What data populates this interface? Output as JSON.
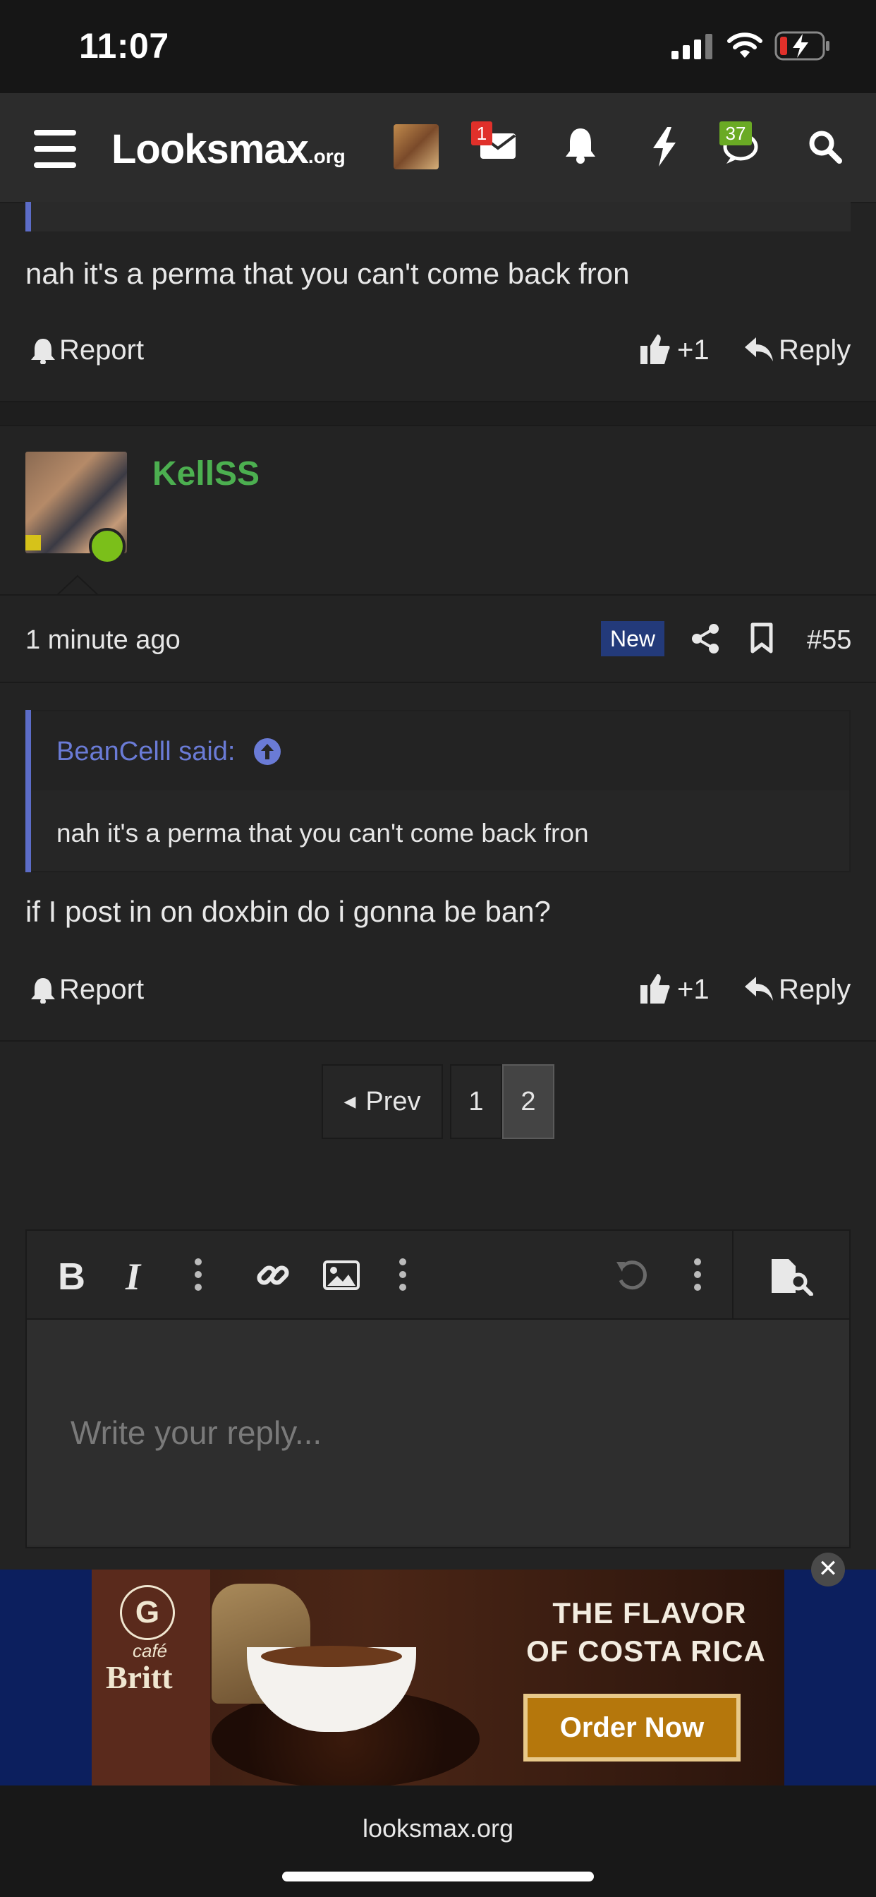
{
  "status_bar": {
    "time": "11:07"
  },
  "nav": {
    "logo_main": "Looksmax",
    "logo_tld": ".org",
    "inbox_count": "1",
    "alerts_count": "37"
  },
  "prev_post": {
    "body": "nah it's a perma that you can't come back fron",
    "report_label": "Report",
    "like_count": "+1",
    "reply_label": "Reply"
  },
  "post": {
    "username": "KellSS",
    "time": "1 minute ago",
    "new_badge": "New",
    "post_number": "#55",
    "quote": {
      "author": "BeanCelll said:",
      "text": "nah it's a perma that you can't come back fron"
    },
    "body": "if I post in on doxbin do i gonna be ban?",
    "report_label": "Report",
    "like_count": "+1",
    "reply_label": "Reply"
  },
  "pagination": {
    "prev_label": "Prev",
    "pages": [
      "1",
      "2"
    ],
    "current_page": "2"
  },
  "editor": {
    "placeholder": "Write your reply..."
  },
  "ad": {
    "brand_top": "café",
    "brand": "Britt",
    "headline_1": "THE FLAVOR",
    "headline_2": "OF COSTA RICA",
    "cta": "Order Now"
  },
  "browser": {
    "url": "looksmax.org"
  },
  "colors": {
    "username_green": "#4caf50",
    "link_blue": "#6a7bd6",
    "new_badge_bg": "#233a7a",
    "inbox_badge": "#e0302a",
    "alerts_badge": "#6aaa24"
  }
}
